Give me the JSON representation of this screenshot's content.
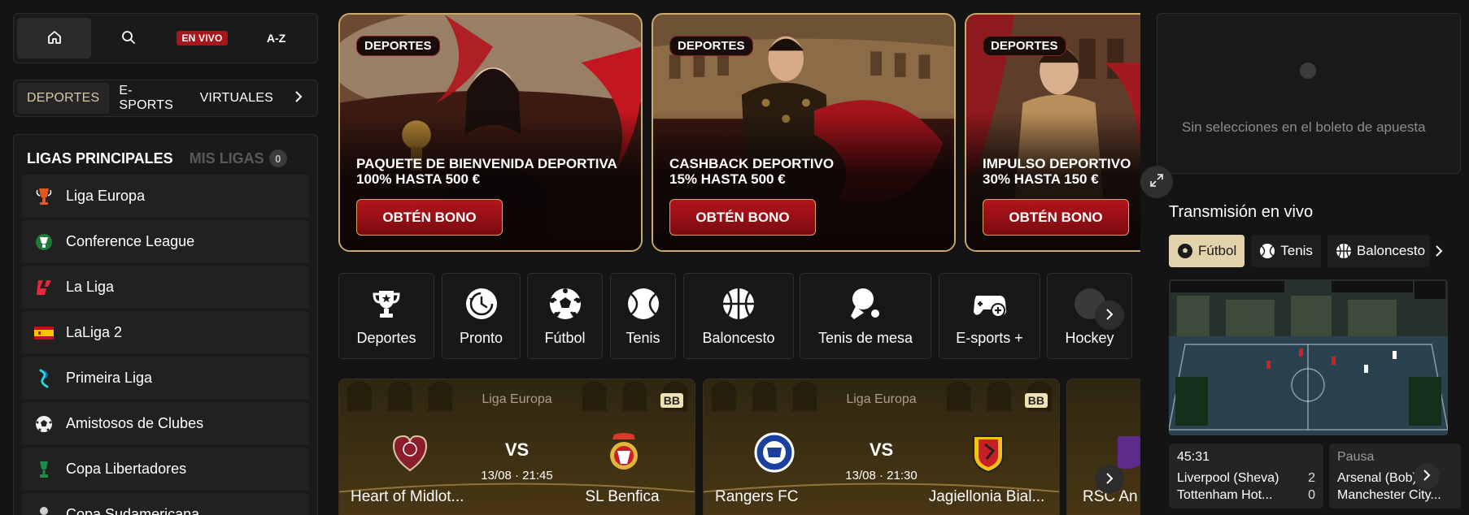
{
  "topnav": {
    "live_label": "EN VIVO",
    "az_label": "A-Z"
  },
  "tabs": [
    "DEPORTES",
    "E-SPORTS",
    "VIRTUALES"
  ],
  "leagues": {
    "main_label": "LIGAS PRINCIPALES",
    "my_label": "MIS LIGAS",
    "my_count": "0",
    "items": [
      {
        "name": "Liga Europa",
        "icon": "europa-league-icon"
      },
      {
        "name": "Conference League",
        "icon": "conference-league-icon"
      },
      {
        "name": "La Liga",
        "icon": "laliga-icon"
      },
      {
        "name": "LaLiga 2",
        "icon": "spain-flag-icon"
      },
      {
        "name": "Primeira Liga",
        "icon": "primeira-liga-icon"
      },
      {
        "name": "Amistosos de Clubes",
        "icon": "soccer-ball-icon"
      },
      {
        "name": "Copa Libertadores",
        "icon": "libertadores-trophy-icon"
      },
      {
        "name": "Copa Sudamericana",
        "icon": "sudamericana-icon"
      }
    ]
  },
  "promos": [
    {
      "tag": "DEPORTES",
      "title": "PAQUETE DE BIENVENIDA DEPORTIVA",
      "subtitle": "100% HASTA 500 €",
      "cta": "OBTÉN BONO"
    },
    {
      "tag": "DEPORTES",
      "title": "CASHBACK DEPORTIVO",
      "subtitle": "15% HASTA 500 €",
      "cta": "OBTÉN BONO"
    },
    {
      "tag": "DEPORTES",
      "title": "IMPULSO DEPORTIVO",
      "subtitle": "30% HASTA 150 €",
      "cta": "OBTÉN BONO"
    }
  ],
  "categories": [
    {
      "label": "Deportes",
      "icon": "trophy-icon"
    },
    {
      "label": "Pronto",
      "icon": "clock-icon"
    },
    {
      "label": "Fútbol",
      "icon": "soccer-ball-icon"
    },
    {
      "label": "Tenis",
      "icon": "tennis-ball-icon"
    },
    {
      "label": "Baloncesto",
      "icon": "basketball-icon"
    },
    {
      "label": "Tenis de mesa",
      "icon": "table-tennis-icon"
    },
    {
      "label": "E-sports +",
      "icon": "gamepad-icon"
    },
    {
      "label": "Hockey",
      "icon": "hockey-icon"
    }
  ],
  "matches": [
    {
      "league": "Liga Europa",
      "badge": "BB",
      "vs": "VS",
      "datetime": "13/08 · 21:45",
      "home": "Heart of Midlot...",
      "away": "SL Benfica"
    },
    {
      "league": "Liga Europa",
      "badge": "BB",
      "vs": "VS",
      "datetime": "13/08 · 21:30",
      "home": "Rangers FC",
      "away": "Jagiellonia Bial..."
    },
    {
      "home": "RSC An"
    }
  ],
  "betslip": {
    "empty_message": "Sin selecciones en el boleto de apuesta"
  },
  "stream": {
    "title": "Transmisión en vivo",
    "tabs": [
      "Fútbol",
      "Tenis",
      "Baloncesto"
    ],
    "cards": [
      {
        "time": "45:31",
        "team1": "Liverpool (Sheva)",
        "score1": "2",
        "team2": "Tottenham Hot...",
        "score2": "0"
      },
      {
        "time": "Pausa",
        "team1": "Arsenal (Bob)",
        "score1": "",
        "team2": "Manchester City...",
        "score2": ""
      }
    ]
  },
  "colors": {
    "accent_gold": "#c9a96e",
    "live_red": "#a8161d",
    "cta_red": "#b4141c",
    "active_tab_bg": "#e3d3aa"
  }
}
